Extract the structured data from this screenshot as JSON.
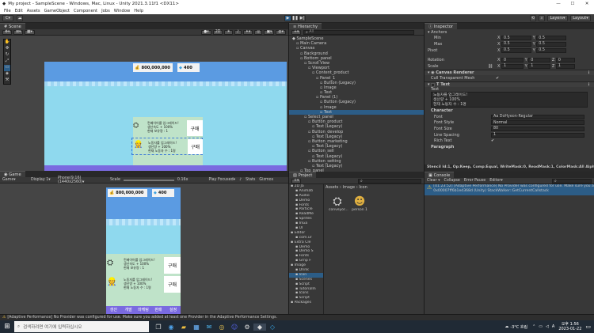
{
  "window": {
    "title": "My project - SampleScene - Windows, Mac, Linux - Unity 2021.3.11f1 <DX11>"
  },
  "menu": [
    "File",
    "Edit",
    "Assets",
    "GameObject",
    "Component",
    "Jobs",
    "Window",
    "Help"
  ],
  "toolbar": {
    "account": "C",
    "layers": "Layers",
    "layout": "Layout"
  },
  "scene": {
    "tab": "Scene",
    "mode_2d": "2D"
  },
  "game": {
    "tab": "Game",
    "display_tab": "Game",
    "display": "Display 1",
    "resolution": "Phone(9:16) (1440x2560)",
    "scale_label": "Scale",
    "scale_value": "0.16x",
    "play_focused": "Play Focused",
    "stats": "Stats",
    "gizmos": "Gizmos"
  },
  "ui_preview": {
    "money": "800,000,000",
    "gems": "400",
    "buy_label": "구매",
    "items": [
      {
        "line1": "컨베이어를 업그레이드!",
        "line2": "생산속도 + 100%",
        "line3": "현재 보유량 : 1"
      },
      {
        "line1": "노동자를 업그레이드!",
        "line2": "생산량 + 100%",
        "line3": "현재 노동자 수 : 1명"
      }
    ],
    "tabs": [
      "생산",
      "개발",
      "마케팅",
      "판매",
      "설정"
    ]
  },
  "hierarchy": {
    "tab": "Hierarchy",
    "search_placeholder": "All",
    "items": [
      {
        "label": "SampleScene",
        "depth": 0
      },
      {
        "label": "Main Camera",
        "depth": 1
      },
      {
        "label": "Canvas",
        "depth": 1
      },
      {
        "label": "Background",
        "depth": 2
      },
      {
        "label": "Bottom_panel",
        "depth": 2
      },
      {
        "label": "Scroll View",
        "depth": 3
      },
      {
        "label": "Viewport",
        "depth": 4
      },
      {
        "label": "Content_product",
        "depth": 5
      },
      {
        "label": "Panel_1",
        "depth": 6
      },
      {
        "label": "Button (Legacy)",
        "depth": 7
      },
      {
        "label": "Image",
        "depth": 7
      },
      {
        "label": "Text",
        "depth": 7
      },
      {
        "label": "Panel (1)",
        "depth": 6
      },
      {
        "label": "Button (Legacy)",
        "depth": 7
      },
      {
        "label": "Image",
        "depth": 7
      },
      {
        "label": "Text",
        "depth": 7
      },
      {
        "label": "Select_panel",
        "depth": 3
      },
      {
        "label": "Button_product",
        "depth": 4
      },
      {
        "label": "Text (Legacy)",
        "depth": 5
      },
      {
        "label": "Button_develop",
        "depth": 4
      },
      {
        "label": "Text (Legacy)",
        "depth": 5
      },
      {
        "label": "Button_marketing",
        "depth": 4
      },
      {
        "label": "Text (Legacy)",
        "depth": 5
      },
      {
        "label": "Button_sell",
        "depth": 4
      },
      {
        "label": "Text (Legacy)",
        "depth": 5
      },
      {
        "label": "Button_setting",
        "depth": 4
      },
      {
        "label": "Text (Legacy)",
        "depth": 5
      },
      {
        "label": "Top_panel",
        "depth": 2
      }
    ]
  },
  "project": {
    "tab": "Project",
    "breadcrumb": [
      "Assets",
      "Image",
      "Icon"
    ],
    "tree": [
      "2D Ja",
      "Animati",
      "Audio",
      "Demo",
      "Fonts",
      "Particle",
      "ReadMe",
      "Sprites",
      "InGa",
      "UI",
      "Editor",
      "com.ur",
      "Extra Cle",
      "Demo",
      "Demo S",
      "Fonts",
      "Grnp F",
      "Image",
      "Drink",
      "Icon",
      "Scenes",
      "Script",
      "Tutorialln",
      "Icons",
      "Script",
      "Packages"
    ],
    "assets": [
      {
        "name": "conveyor..."
      },
      {
        "name": "person 1"
      }
    ]
  },
  "inspector": {
    "tab": "Inspector",
    "anchors_label": "Anchors",
    "min": {
      "label": "Min",
      "x": "0.5",
      "y": "0.5"
    },
    "max": {
      "label": "Max",
      "x": "0.5",
      "y": "0.5"
    },
    "pivot": {
      "label": "Pivot",
      "x": "0.5",
      "y": "0.5"
    },
    "rotation": {
      "label": "Rotation",
      "x": "0",
      "y": "0",
      "z": "0"
    },
    "scale": {
      "label": "Scale",
      "x": "1",
      "y": "1",
      "z": "1"
    },
    "canvas_renderer": "Canvas Renderer",
    "cull_transparent": "Cull Transparent Mesh",
    "text_component": "Text",
    "text_label": "Text",
    "text_value": [
      "노동자를 업그레이드!",
      "생산량 + 100%",
      "현재 노동자 수 : 1명"
    ],
    "character_label": "Character",
    "font": {
      "label": "Font",
      "value": "DoHyeon-Regular"
    },
    "font_style": {
      "label": "Font Style",
      "value": "Normal"
    },
    "font_size": {
      "label": "Font Size",
      "value": "80"
    },
    "line_spacing": {
      "label": "Line Spacing",
      "value": "1"
    },
    "rich_text": {
      "label": "Rich Text"
    },
    "paragraph_label": "Paragraph",
    "stencil_info": "Stencil Id:1, Op:Keep, Comp:Equal, WriteMask:0, ReadMask:1, ColorMask:All Alpha"
  },
  "console": {
    "tab": "Console",
    "clear": "Clear",
    "collapse": "Collapse",
    "error_pause": "Error Pause",
    "editor": "Editor",
    "message_line1": "[01:23:52] [Adaptive Performance] No Provider was configured for use. Make sure you added",
    "message_line2": "0x00007ff6b1ed368d (Unity) StackWalker::GetCurrentCallstack"
  },
  "status": {
    "message": "[Adaptive Performance] No Provider was configured for use. Make sure you added at least one Provider in the Adaptive Performance Settings."
  },
  "taskbar": {
    "search_placeholder": "검색하려면 여기에 입력하십시오",
    "weather": "-3°C 흐림",
    "time": "오후 1:56",
    "date": "2023-01-22"
  },
  "colors": {
    "sky": "#5b9be2",
    "water": "#8fd9ee",
    "panel_green": "#bfe3c9",
    "tab_purple": "#7a6ae0",
    "selection": "#2c5d87"
  }
}
